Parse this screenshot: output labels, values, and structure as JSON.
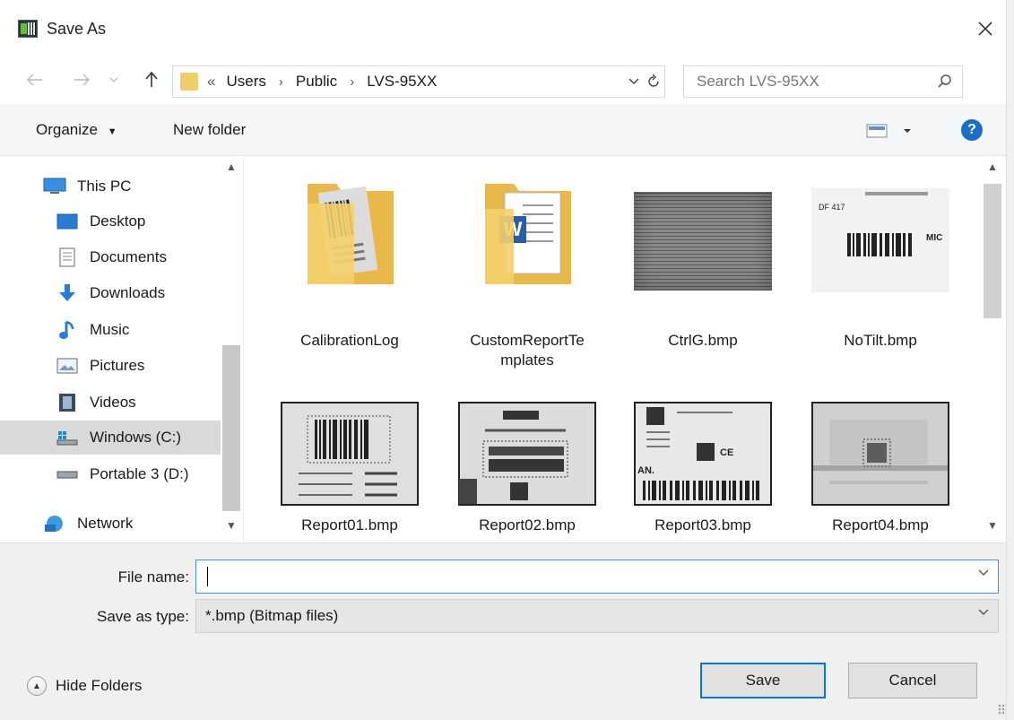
{
  "window": {
    "title": "Save As",
    "app_icon": "barcode-app-icon"
  },
  "address_bar": {
    "prefix": "«",
    "crumbs": [
      "Users",
      "Public",
      "LVS-95XX"
    ]
  },
  "search": {
    "placeholder": "Search LVS-95XX"
  },
  "toolbar": {
    "organize_label": "Organize",
    "new_folder_label": "New folder",
    "help_label": "?"
  },
  "sidebar": {
    "items": [
      {
        "label": "This PC",
        "icon": "computer-icon"
      },
      {
        "label": "Desktop",
        "icon": "desktop-icon"
      },
      {
        "label": "Documents",
        "icon": "documents-icon"
      },
      {
        "label": "Downloads",
        "icon": "downloads-icon"
      },
      {
        "label": "Music",
        "icon": "music-icon"
      },
      {
        "label": "Pictures",
        "icon": "pictures-icon"
      },
      {
        "label": "Videos",
        "icon": "videos-icon"
      },
      {
        "label": "Windows (C:)",
        "icon": "windows-drive-icon",
        "selected": true
      },
      {
        "label": "Portable 3 (D:)",
        "icon": "drive-icon"
      },
      {
        "label": "Network",
        "icon": "network-icon"
      }
    ]
  },
  "files": [
    {
      "name": "CalibrationLog",
      "type": "folder"
    },
    {
      "name": "CustomReportTe\nmplates",
      "type": "folder"
    },
    {
      "name": "CtrlG.bmp",
      "type": "image"
    },
    {
      "name": "NoTilt.bmp",
      "type": "image"
    },
    {
      "name": "Report01.bmp",
      "type": "image"
    },
    {
      "name": "Report02.bmp",
      "type": "image"
    },
    {
      "name": "Report03.bmp",
      "type": "image"
    },
    {
      "name": "Report04.bmp",
      "type": "image"
    }
  ],
  "form": {
    "file_name_label": "File name:",
    "file_name_value": "",
    "save_as_type_label": "Save as type:",
    "save_as_type_value": "*.bmp (Bitmap files)"
  },
  "footer": {
    "hide_folders_label": "Hide Folders",
    "save_label": "Save",
    "cancel_label": "Cancel"
  },
  "colors": {
    "accent": "#0078d7",
    "help": "#1a6fc5",
    "folder": "#f0cd6a",
    "selected": "#d9d9d9"
  }
}
